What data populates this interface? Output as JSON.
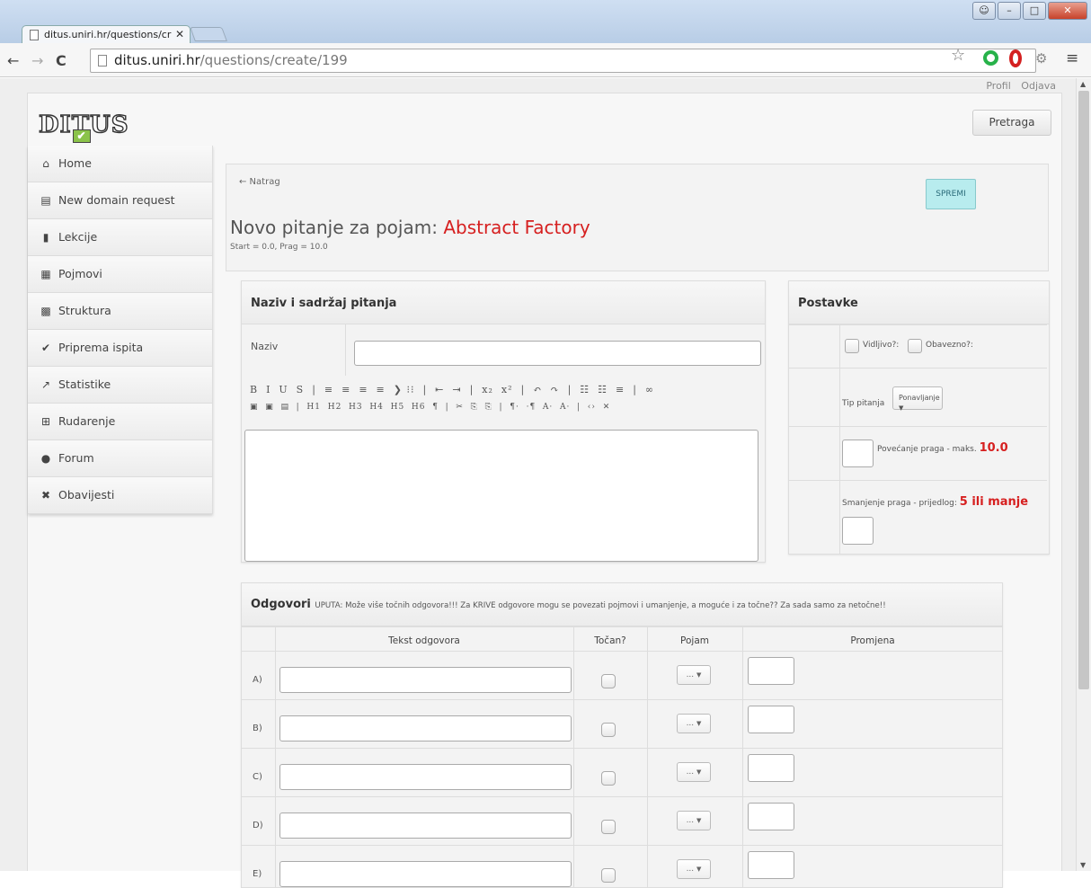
{
  "browser": {
    "tab_title": "ditus.uniri.hr/questions/cr",
    "url_host": "ditus.uniri.hr",
    "url_path": "/questions/create/199",
    "back_icon": "arrow-left-icon",
    "forward_icon": "arrow-right-icon",
    "reload_icon": "reload-icon",
    "star_icon": "star-icon",
    "menu_icon": "hamburger-icon"
  },
  "top_links": {
    "profil": "Profil",
    "odjava": "Odjava"
  },
  "logo": "DITUS",
  "search_button": "Pretraga",
  "sidebar": {
    "items": [
      {
        "label": "Home",
        "icon": "home-icon",
        "glyph": "⌂"
      },
      {
        "label": "New domain request",
        "icon": "keyboard-icon",
        "glyph": "▤"
      },
      {
        "label": "Lekcije",
        "icon": "book-icon",
        "glyph": "▮"
      },
      {
        "label": "Pojmovi",
        "icon": "grid-icon",
        "glyph": "▦"
      },
      {
        "label": "Struktura",
        "icon": "qr-icon",
        "glyph": "▩"
      },
      {
        "label": "Priprema ispita",
        "icon": "check-icon",
        "glyph": "✔"
      },
      {
        "label": "Statistike",
        "icon": "chart-icon",
        "glyph": "↗"
      },
      {
        "label": "Rudarenje",
        "icon": "sitemap-icon",
        "glyph": "⊞"
      },
      {
        "label": "Forum",
        "icon": "comments-icon",
        "glyph": "●"
      },
      {
        "label": "Obavijesti",
        "icon": "announcement-icon",
        "glyph": "✖"
      }
    ]
  },
  "header": {
    "back_link": "← Natrag",
    "save_button": "SPREMI",
    "title_prefix": "Novo pitanje za pojam:",
    "title_concept": "Abstract Factory",
    "subtitle": "Start = 0.0, Prag = 10.0"
  },
  "question_panel": {
    "title": "Naziv i sadržaj pitanja",
    "name_label": "Naziv",
    "name_value": "",
    "toolbar_row1": "B  I  U  S  |  ≡  ≡  ≡  ≡  ❯ ⁝⁝  |  ⇤  ⇥  |  x₂  x²  |  ↶  ↷  |  ☷  ☷  ≡  |  ∞",
    "toolbar_row2": "▣  ▣  ▤  |  H1  H2  H3  H4  H5  H6  ¶  |  ✂  ⎘  ⎘  |  ¶·  ·¶  A·  A·  |  ‹›  ✕"
  },
  "settings_panel": {
    "title": "Postavke",
    "visible_label": "Vidljivo?:",
    "required_label": "Obavezno?:",
    "type_label": "Tip pitanja",
    "type_value": "Ponavljanje",
    "increase_label": "Povećanje praga - maks.",
    "increase_max": "10.0",
    "decrease_label": "Smanjenje praga - prijedlog:",
    "decrease_suggest": "5 ili manje"
  },
  "answers_panel": {
    "title": "Odgovori",
    "instructions": "UPUTA: Može više točnih odgovora!!! Za KRIVE odgovore mogu se povezati pojmovi i umanjenje, a moguće i za točne?? Za sada samo za netočne!!",
    "columns": [
      "Tekst odgovora",
      "Točan?",
      "Pojam",
      "Promjena"
    ],
    "rows": [
      {
        "letter": "A)"
      },
      {
        "letter": "B)"
      },
      {
        "letter": "C)"
      },
      {
        "letter": "D)"
      },
      {
        "letter": "E)"
      }
    ],
    "dropdown_label": "..."
  }
}
